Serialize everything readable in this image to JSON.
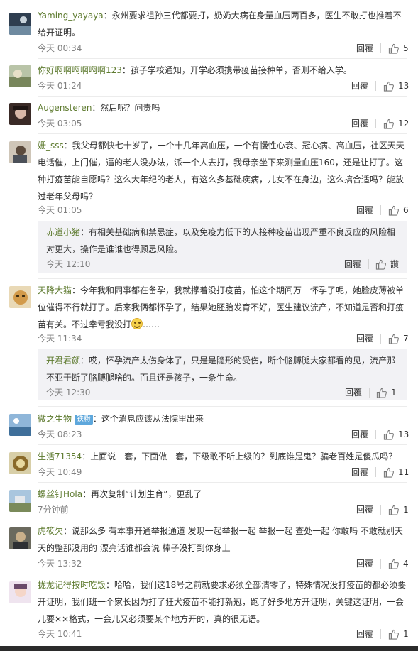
{
  "labels": {
    "reply": "回覆"
  },
  "comments": [
    {
      "user": "Yaming_yayaya",
      "content": "：永州要求祖孙三代都要打，奶奶大病在身量血压两百多，医生不敢打也推着不给开证明。",
      "time": "今天 00:34",
      "likes": "5"
    },
    {
      "user": "你好啊啊啊啊啊啊123",
      "content": "：孩子学校通知，开学必须携带疫苗接种单，否则不给入学。",
      "time": "今天 01:24",
      "likes": "13"
    },
    {
      "user": "Augensteren",
      "content": "：然后呢？问责吗",
      "time": "今天 03:05",
      "likes": "12"
    },
    {
      "user": "姗_sss",
      "content": "：我父母都快七十岁了，一个十几年高血压，一个有慢性心衰、冠心病、高血压，社区天天电话催，上门催，逼的老人没办法，派一个人去打，我母亲坐下来测量血压160，还是让打了。这种打疫苗能自愿吗？这么大年纪的老人，有这么多基础疾病，儿女不在身边，这么搞合适吗？能放过老年父母吗？",
      "time": "今天 01:05",
      "likes": "6"
    },
    {
      "user": "赤道小猪",
      "content": "：有相关基础病和禁忌症，以及免疫力低下的人接种疫苗出现严重不良反应的风险相对更大，操作是谁谁也得顾忌风险。",
      "time": "今天 12:10",
      "likes": "讚"
    },
    {
      "user": "天降大猫",
      "content": "：今年我和同事都在备孕，我就撑着没打疫苗，怕这个期间万一怀孕了呢，她脸皮薄被单位催得不行就打了。后来我俩都怀孕了，结果她胚胎发育不好，医生建议流产，不知道是否和打疫苗有关。不过幸亏我没打",
      "after": "……",
      "time": "今天 11:34",
      "likes": "7"
    },
    {
      "user": "开君君颜",
      "content": "：哎，怀孕流产太伤身体了，只是是隐形的受伤，断个胳膊腿大家都看的见，流产那不亚于断了胳膊腿啥的。而且还是孩子，一条生命。",
      "time": "今天 12:30",
      "likes": "1"
    },
    {
      "user": "微之生物",
      "badge": "铁粉",
      "content": "：这个消息应该从法院里出来",
      "time": "今天 08:23",
      "likes": "13"
    },
    {
      "user": "生活71354",
      "content": "：上面说一套，下面做一套，下级敢不听上级的？到底谁是鬼？骗老百姓是傻瓜吗？",
      "time": "今天 10:49",
      "likes": "11"
    },
    {
      "user": "螺丝钉Hola",
      "content": "：再次复制“计划生育”，更乱了",
      "time": "7分钟前",
      "likes": "1"
    },
    {
      "user": "虎筱欠",
      "content": "：说那么多 有本事开通举报通道 发现一起举报一起 举报一起 查处一起 你敢吗 不敢就别天天的整那没用的 漂亮话谁都会说 棒子没打到你身上",
      "time": "今天 13:32",
      "likes": "4"
    },
    {
      "user": "拢龙记得按时吃饭",
      "content": "：哈哈，我们这18号之前就要求必须全部清零了，特殊情况没打疫苗的都必须要开证明，我们班一个家长因为打了狂犬疫苗不能打新冠，跑了好多地方开证明，关键这证明，一会儿要××格式，一会儿又必须要某个地方开的，真的很无语。",
      "time": "今天 10:41",
      "likes": "1"
    }
  ]
}
